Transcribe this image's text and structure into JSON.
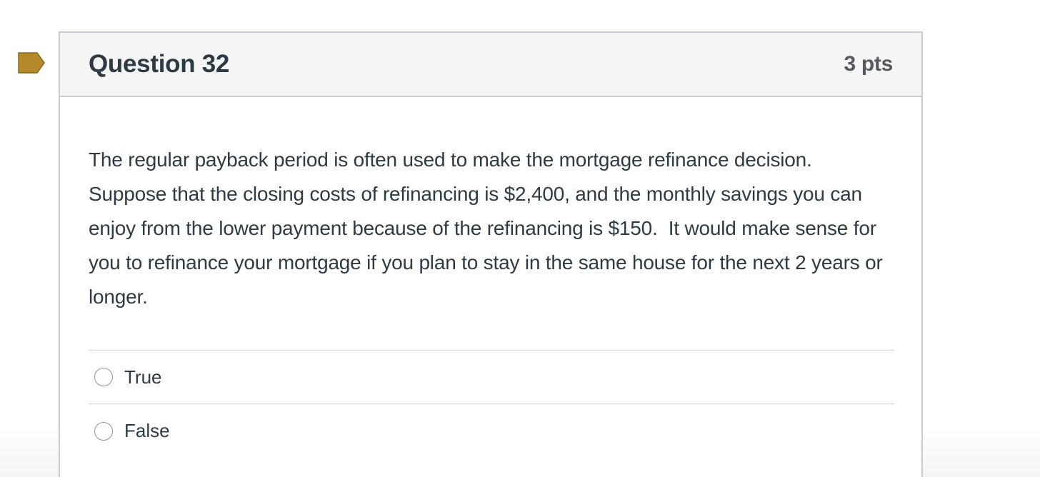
{
  "question": {
    "title": "Question 32",
    "points": "3 pts",
    "text": "The regular payback period is often used to make the mortgage refinance decision.  Suppose that the closing costs of refinancing is $2,400, and the monthly savings you can enjoy from the lower payment because of the refinancing is $150.  It would make sense for you to refinance your mortgage if you plan to stay in the same house for the next 2 years or longer.",
    "answers": [
      {
        "label": "True"
      },
      {
        "label": "False"
      }
    ]
  },
  "colors": {
    "flag": "#b5892a",
    "header_bg": "#f5f5f5",
    "border": "#c7cdd1",
    "text": "#2d3b45"
  },
  "icons": {
    "flag": "flag-icon",
    "radio": "radio-unselected-icon"
  }
}
